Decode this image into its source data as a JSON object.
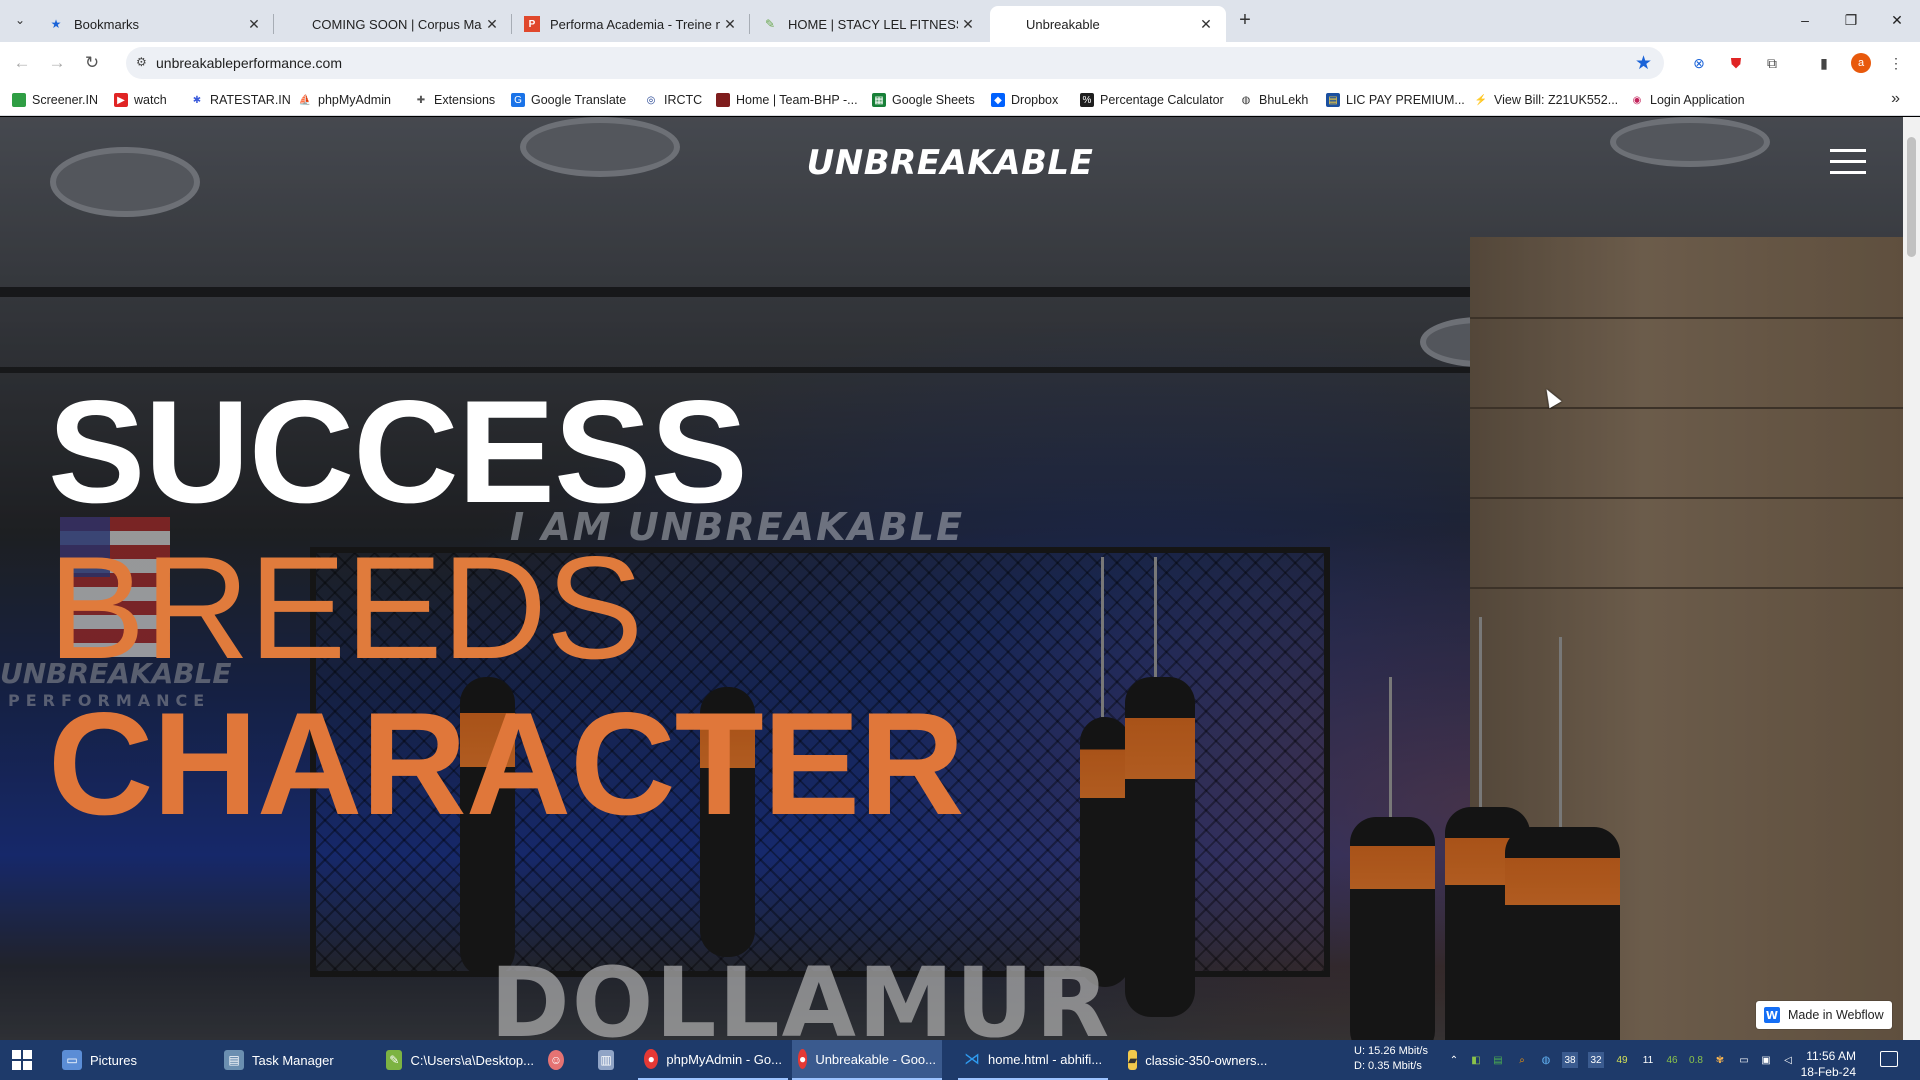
{
  "browser": {
    "tabs": [
      {
        "title": "Bookmarks",
        "icon": "star-icon"
      },
      {
        "title": "COMING SOON | Corpus Maxim",
        "icon": "none"
      },
      {
        "title": "Performa Academia - Treine na",
        "icon": "performa-icon"
      },
      {
        "title": "HOME | STACY LEL FITNESS",
        "icon": "wix-icon"
      },
      {
        "title": "Unbreakable",
        "icon": "none",
        "active": true
      }
    ],
    "new_tab": "+",
    "window_controls": {
      "minimize": "–",
      "restore": "❐",
      "close": "✕"
    },
    "url": "unbreakableperformance.com",
    "profile_initial": "a",
    "bookmarks": [
      {
        "label": "Screener.IN",
        "color": "#2f9e44"
      },
      {
        "label": "watch",
        "color": "#e02424"
      },
      {
        "label": "RATESTAR.IN",
        "color": "#3b5bdb"
      },
      {
        "label": "phpMyAdmin",
        "color": "#e8590c"
      },
      {
        "label": "Extensions",
        "color": "#555555"
      },
      {
        "label": "Google Translate",
        "color": "#1a73e8"
      },
      {
        "label": "IRCTC",
        "color": "#1c3d8f"
      },
      {
        "label": "Home | Team-BHP -...",
        "color": "#7f1d1d"
      },
      {
        "label": "Google Sheets",
        "color": "#188038"
      },
      {
        "label": "Dropbox",
        "color": "#0061fe"
      },
      {
        "label": "Percentage Calculator",
        "color": "#1e1e1e"
      },
      {
        "label": "BhuLekh",
        "color": "#333333"
      },
      {
        "label": "LIC PAY PREMIUM...",
        "color": "#1a4fa0"
      },
      {
        "label": "View Bill: Z21UK552...",
        "color": "#c0392b"
      },
      {
        "label": "Login Application",
        "color": "#c2255c"
      }
    ]
  },
  "site": {
    "logo": "UNBREAKABLE",
    "hero": {
      "line1": "SUCCESS",
      "line2": "BREEDS",
      "line3": "CHARACTER"
    },
    "photo_text": {
      "neon": "I AM UNBREAKABLE",
      "wall_logo": "UNBREAKABLE",
      "wall_sub": "PERFORMANCE",
      "mat_brand": "DOLLAMUR"
    },
    "webflow_badge": "Made in Webflow",
    "accent_color": "#e07b3c"
  },
  "taskbar": {
    "items": [
      {
        "label": "Pictures"
      },
      {
        "label": "Task Manager"
      },
      {
        "label": "C:\\Users\\a\\Desktop..."
      },
      {
        "label": ""
      },
      {
        "label": ""
      },
      {
        "label": "phpMyAdmin - Go..."
      },
      {
        "label": "Unbreakable - Goo...",
        "active": true
      },
      {
        "label": "home.html - abhifi..."
      },
      {
        "label": "classic-350-owners..."
      }
    ],
    "net_up": "U:    15.26 Mbit/s",
    "net_down": "D:     0.35 Mbit/s",
    "tray_numbers": [
      "38",
      "32",
      "49",
      "11",
      "46",
      "0.8"
    ],
    "time": "11:56 AM",
    "date": "18-Feb-24"
  }
}
